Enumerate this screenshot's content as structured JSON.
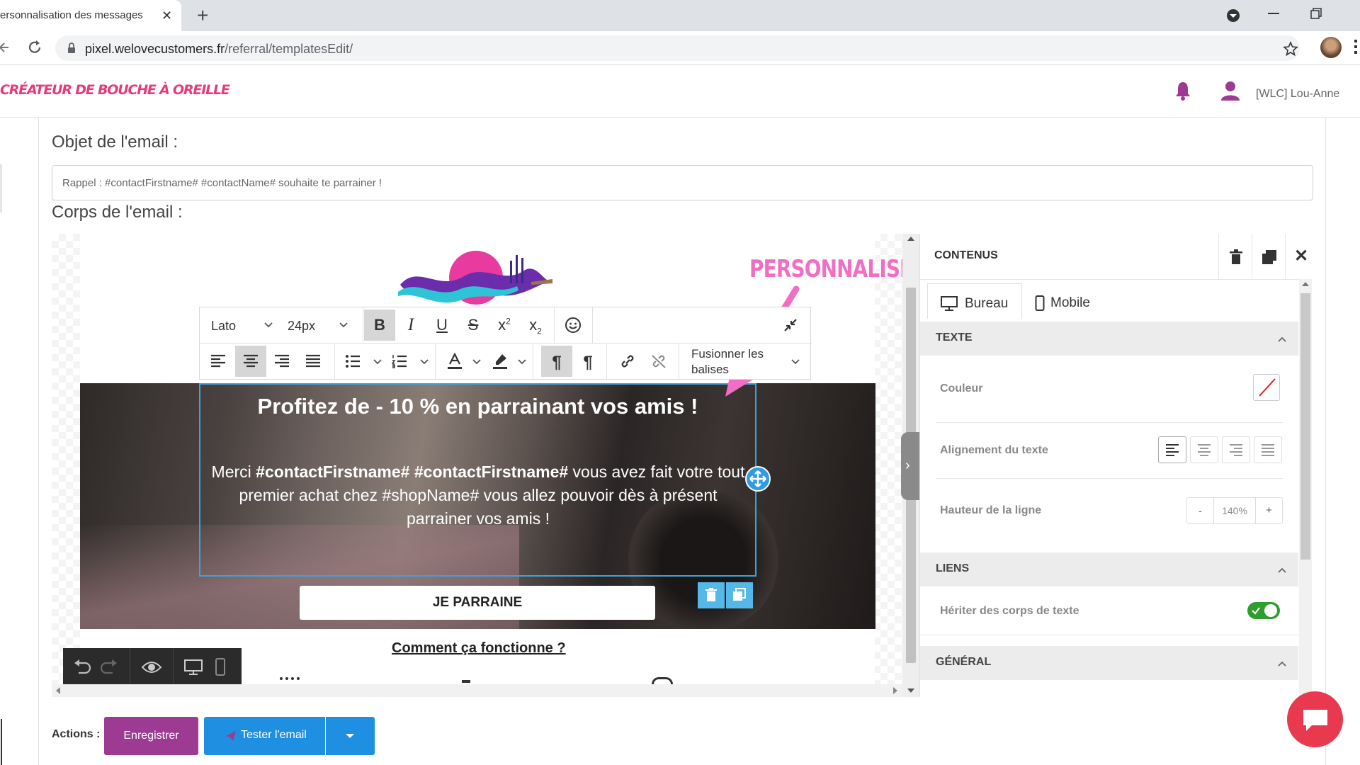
{
  "browser": {
    "tab_title": "ersonnalisation des messages W",
    "url_host": "pixel.welovecustomers.fr",
    "url_path": "/referral/templatesEdit/"
  },
  "header": {
    "logo_text": "CRÉATEUR DE BOUCHE À OREILLE",
    "user_name": "[WLC] Lou-Anne"
  },
  "form": {
    "subject_label": "Objet de l'email :",
    "subject_value": "Rappel : #contactFirstname# #contactName# souhaite te parrainer !",
    "body_label": "Corps de l'email :"
  },
  "toolbar": {
    "font_family": "Lato",
    "font_size": "24px",
    "merge_tags_line1": "Fusionner les",
    "merge_tags_line2": "balises"
  },
  "email": {
    "hero_title": "Profitez de - 10 % en parrainant vos amis !",
    "body_prefix": "Merci ",
    "body_tag1": "#contactFirstname#",
    "body_space": " ",
    "body_tag2": "#contactFirstname#",
    "body_rest": " vous avez fait votre tout premier achat chez #shopName# vous allez pouvoir dès à présent parrainer vos amis !",
    "cta_label": "JE PARRAINE",
    "how_it_works": "Comment ça fonctionne ?"
  },
  "annotation": {
    "text": "PERSONNALISEZ",
    "color": "#f06fc4"
  },
  "panel": {
    "title": "CONTENUS",
    "tab_desktop": "Bureau",
    "tab_mobile": "Mobile",
    "section_text": "TEXTE",
    "color_label": "Couleur",
    "align_label": "Alignement du texte",
    "line_height_label": "Hauteur de la ligne",
    "line_height_minus": "-",
    "line_height_value": "140%",
    "line_height_plus": "+",
    "section_links": "LIENS",
    "inherit_label": "Hériter des corps de texte",
    "inherit_on": true,
    "section_general": "GÉNÉRAL"
  },
  "actions": {
    "label": "Actions :",
    "save": "Enregistrer",
    "test": "Tester l'email"
  },
  "colors": {
    "brand_pink": "#e63b7a",
    "save_purple": "#9c3b91",
    "primary_blue": "#1f8fe2",
    "selection_blue": "#39a4dd",
    "toggle_green": "#2e9e2e",
    "chat_red": "#e8394f"
  }
}
